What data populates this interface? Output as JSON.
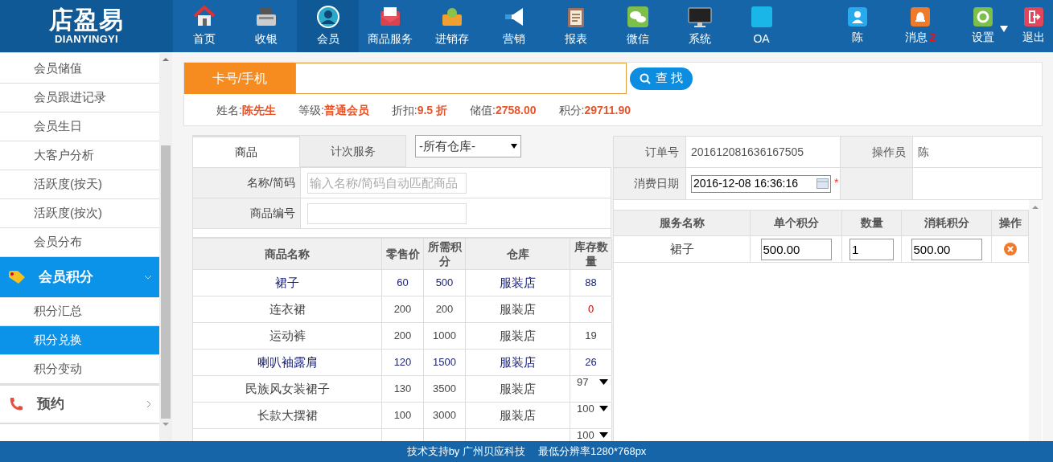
{
  "logo": {
    "name": "店盈易",
    "subtitle": "DIANYINGYI"
  },
  "nav": [
    {
      "label": "首页",
      "selected": false
    },
    {
      "label": "收银",
      "selected": false
    },
    {
      "label": "会员",
      "selected": true
    },
    {
      "label": "商品服务",
      "selected": false
    },
    {
      "label": "进销存",
      "selected": false
    },
    {
      "label": "营销",
      "selected": false
    },
    {
      "label": "报表",
      "selected": false
    },
    {
      "label": "微信",
      "selected": false
    },
    {
      "label": "系统",
      "selected": false
    },
    {
      "label": "OA",
      "selected": false
    }
  ],
  "user_menu": [
    {
      "label": "陈"
    },
    {
      "label": "消息",
      "badge": "2"
    },
    {
      "label": "设置",
      "dropdown": true
    },
    {
      "label": "退出"
    }
  ],
  "sidebar": {
    "items": [
      {
        "kind": "link",
        "label": "会员储值",
        "selected": false
      },
      {
        "kind": "link",
        "label": "会员跟进记录",
        "selected": false
      },
      {
        "kind": "link",
        "label": "会员生日",
        "selected": false
      },
      {
        "kind": "link",
        "label": "大客户分析",
        "selected": false
      },
      {
        "kind": "link",
        "label": "活跃度(按天)",
        "selected": false
      },
      {
        "kind": "link",
        "label": "活跃度(按次)",
        "selected": false
      },
      {
        "kind": "link",
        "label": "会员分布",
        "selected": false
      },
      {
        "kind": "group",
        "label": "会员积分",
        "selected": true,
        "expanded": true,
        "children": [
          {
            "kind": "link",
            "label": "积分汇总",
            "selected": false
          },
          {
            "kind": "link",
            "label": "积分兑换",
            "selected": true
          },
          {
            "kind": "link",
            "label": "积分变动",
            "selected": false
          }
        ]
      },
      {
        "kind": "group",
        "label": "预约",
        "selected": false,
        "expanded": false
      }
    ]
  },
  "member_search": {
    "label": "卡号/手机",
    "button": "查 找"
  },
  "member_info": [
    {
      "label": "姓名:",
      "value": "陈先生"
    },
    {
      "label": "等级:",
      "value": "普通会员"
    },
    {
      "label": "折扣:",
      "value": "9.5 折"
    },
    {
      "label": "储值:",
      "value": "2758.00"
    },
    {
      "label": "积分:",
      "value": "29711.90"
    }
  ],
  "tabs": [
    {
      "label": "商品",
      "selected": true
    },
    {
      "label": "计次服务",
      "selected": false
    }
  ],
  "warehouse_select": {
    "value": "-所有仓库-"
  },
  "filters": [
    {
      "label": "名称/简码",
      "placeholder": "输入名称/简码自动匹配商品"
    },
    {
      "label": "商品编号"
    }
  ],
  "product_table": {
    "columns": [
      "商品名称",
      "零售价",
      "所需积分",
      "仓库",
      "库存数量"
    ],
    "rows": [
      {
        "name": "裙子",
        "price": "60",
        "points": "500",
        "warehouse": "服装店",
        "stock": "88",
        "highlighted": true,
        "out_of_stock": false,
        "dropdown": false
      },
      {
        "name": "连衣裙",
        "price": "200",
        "points": "200",
        "warehouse": "服装店",
        "stock": "0",
        "highlighted": false,
        "out_of_stock": true,
        "dropdown": false
      },
      {
        "name": "运动裤",
        "price": "200",
        "points": "1000",
        "warehouse": "服装店",
        "stock": "19",
        "highlighted": false,
        "out_of_stock": false,
        "dropdown": false
      },
      {
        "name": "喇叭袖露肩",
        "price": "120",
        "points": "1500",
        "warehouse": "服装店",
        "stock": "26",
        "highlighted": true,
        "out_of_stock": false,
        "dropdown": false
      },
      {
        "name": "民族风女装裙子",
        "price": "130",
        "points": "3500",
        "warehouse": "服装店",
        "stock": "97",
        "highlighted": false,
        "out_of_stock": false,
        "dropdown": true
      },
      {
        "name": "长款大摆裙",
        "price": "100",
        "points": "3000",
        "warehouse": "服装店",
        "stock": "100",
        "highlighted": false,
        "out_of_stock": false,
        "dropdown": true
      },
      {
        "stock": "100",
        "highlighted": false,
        "out_of_stock": false,
        "dropdown": true
      }
    ]
  },
  "order": {
    "fields": [
      {
        "label": "订单号",
        "value": "201612081636167505"
      },
      {
        "label": "操作员",
        "value": "陈"
      },
      {
        "label": "消费日期",
        "value": "2016-12-08 16:36:16",
        "required_mark": "*"
      }
    ]
  },
  "service_table": {
    "columns": [
      "服务名称",
      "单个积分",
      "数量",
      "消耗积分",
      "操作"
    ],
    "rows": [
      {
        "name": "裙子",
        "unit_points": "500.00",
        "quantity": "1",
        "total_points": "500.00"
      }
    ]
  },
  "footer": {
    "support": "技术支持by 广州贝应科技",
    "resolution": "最低分辨率1280*768px"
  }
}
